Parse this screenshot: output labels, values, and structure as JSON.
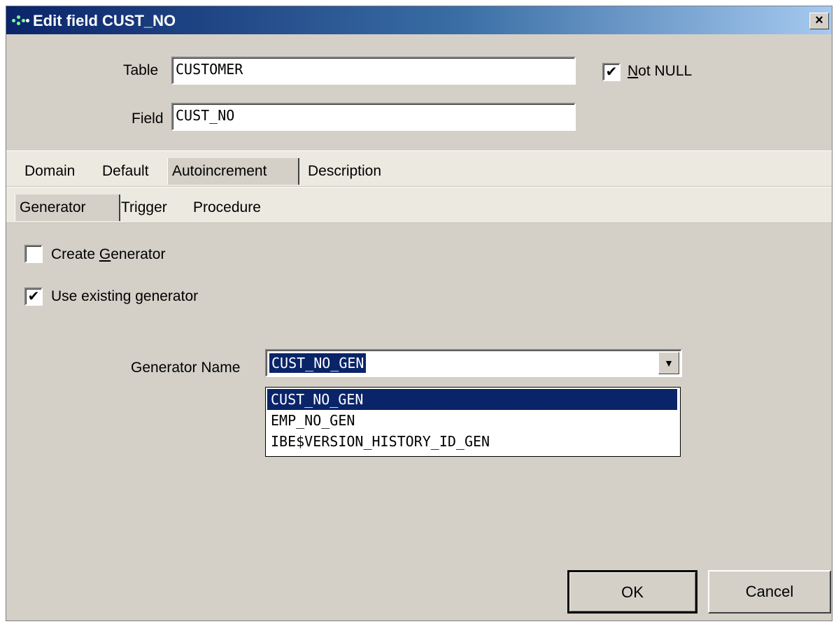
{
  "window": {
    "title": "Edit field CUST_NO",
    "close_label": "×"
  },
  "form": {
    "table_label": "Table",
    "table_value": "CUSTOMER",
    "field_label": "Field",
    "field_value": "CUST_NO",
    "not_null_accel": "N",
    "not_null_rest": "ot NULL",
    "not_null_checked": true
  },
  "tabs": [
    {
      "label": "Domain"
    },
    {
      "label": "Default"
    },
    {
      "label": "Autoincrement",
      "active": true
    },
    {
      "label": "Description"
    }
  ],
  "subtabs": [
    {
      "label": "Generator",
      "active": true
    },
    {
      "label": "Trigger"
    },
    {
      "label": "Procedure"
    }
  ],
  "generator": {
    "create_pre": "Create ",
    "create_accel": "G",
    "create_post": "enerator",
    "create_checked": false,
    "use_existing_label": "Use existing generator",
    "use_existing_checked": true,
    "name_label": "Generator Name",
    "selected_value": "CUST_NO_GEN",
    "options": [
      "CUST_NO_GEN",
      "EMP_NO_GEN",
      "IBE$VERSION_HISTORY_ID_GEN"
    ]
  },
  "buttons": {
    "ok_label": "OK",
    "cancel_label": "Cancel"
  },
  "icons": {
    "check": "✔",
    "dropdown_arrow": "▼"
  },
  "colors": {
    "title_bar": "#0a246a",
    "selection": "#0a246a",
    "dialog_bg": "#d4d0c8"
  }
}
